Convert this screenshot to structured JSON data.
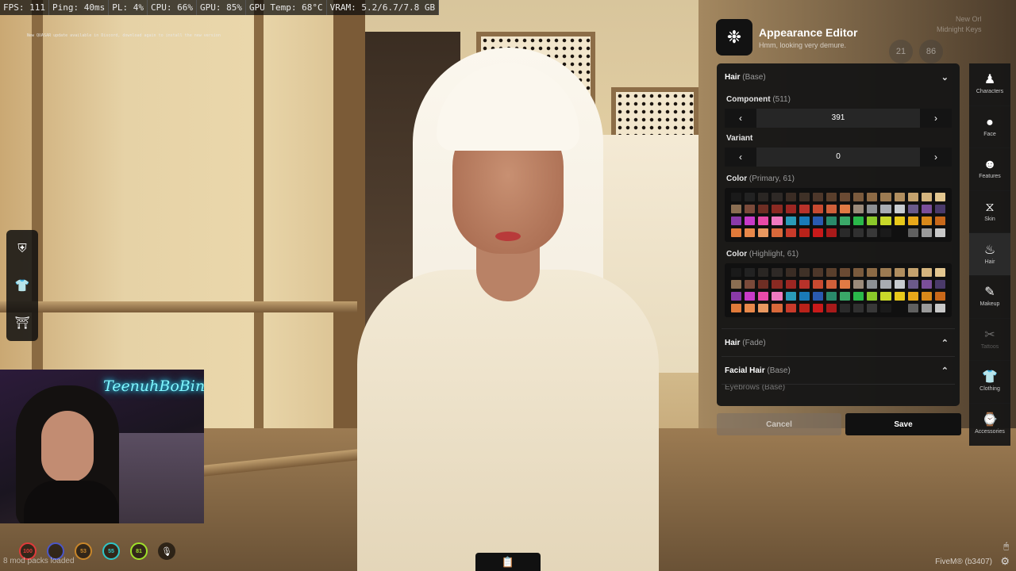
{
  "perf": {
    "fps": "FPS: 111",
    "ping": "Ping: 40ms",
    "pl": "PL: 4%",
    "cpu": "CPU: 66%",
    "gpu": "GPU: 85%",
    "gpu_temp": "GPU Temp: 68°C",
    "vram": "VRAM: 5.2/6.7/7.8 GB"
  },
  "notice": "New QUASAR update available in Discord, download again to install the new version",
  "webcam": {
    "neon_text": "TeenuhBoBina"
  },
  "hud": {
    "health": "100",
    "stat2": "",
    "stat3": "53",
    "stat4": "55",
    "stat5": "81",
    "mic_key": "N",
    "mod_packs": "8 mod packs loaded",
    "fivem_build": "FiveM® (b3407)",
    "colors": [
      "#e03a3a",
      "#4a56c8",
      "#c8862a",
      "#2ec6c8",
      "#9ee02a"
    ]
  },
  "ghost": {
    "lines": [
      "New Orl",
      "Midnight Keys"
    ],
    "nums": [
      "21",
      "86"
    ]
  },
  "editor": {
    "title": "Appearance Editor",
    "subtitle": "Hmm, looking very demure.",
    "sections": {
      "hair_base": {
        "label": "Hair",
        "sub": "(Base)"
      },
      "component": {
        "label": "Component",
        "sub": "(511)",
        "value": "391"
      },
      "variant": {
        "label": "Variant",
        "value": "0"
      },
      "color_primary": {
        "label": "Color",
        "sub": "(Primary, 61)"
      },
      "color_highlight": {
        "label": "Color",
        "sub": "(Highlight, 61)"
      },
      "hair_fade": {
        "label": "Hair",
        "sub": "(Fade)"
      },
      "facial_hair": {
        "label": "Facial Hair",
        "sub": "(Base)"
      },
      "eyebrows": {
        "label": "Eyebrows",
        "sub": "(Base)"
      }
    },
    "palette": [
      "#1a1a1a",
      "#222222",
      "#2a2623",
      "#2e2926",
      "#3a2c24",
      "#3f3127",
      "#4d372a",
      "#5a3f2c",
      "#6a4a33",
      "#7a5a3d",
      "#8c6a45",
      "#9c7b52",
      "#b08e5f",
      "#c4a26e",
      "#d4b47e",
      "#e2c690",
      "#8a6e52",
      "#7a4a3a",
      "#6e2e24",
      "#8a2a22",
      "#9c2622",
      "#b8322a",
      "#c84a30",
      "#d0603a",
      "#e07a44",
      "#9a8a7a",
      "#8c9094",
      "#a8acb2",
      "#c8ccd0",
      "#6a5a8a",
      "#7a4e9a",
      "#4a3a6a",
      "#8a3aa8",
      "#c83ac8",
      "#e84aa8",
      "#f07ac0",
      "#2a9ab8",
      "#1a7ab8",
      "#2a5ab0",
      "#2a8a6a",
      "#3aa868",
      "#2ab84a",
      "#8ac82a",
      "#c8d82a",
      "#e8c81a",
      "#e8a81a",
      "#d8881a",
      "#c8681a",
      "#e07a3a",
      "#e8884a",
      "#e89860",
      "#d8683a",
      "#c83a2a",
      "#b8221a",
      "#c81a1a",
      "#a81a1a",
      "#2a2a2a",
      "#303030",
      "#383838",
      "#1a1a1a",
      "#101010",
      "#606060",
      "#9a9a9a",
      "#c8c8c8"
    ],
    "cancel": "Cancel",
    "save": "Save"
  },
  "categories": [
    {
      "name": "Characters",
      "icon": "person-icon",
      "glyph": "🯅"
    },
    {
      "name": "Face",
      "icon": "face-icon",
      "glyph": "●"
    },
    {
      "name": "Features",
      "icon": "features-icon",
      "glyph": "☻"
    },
    {
      "name": "Skin",
      "icon": "dna-icon",
      "glyph": "⧖"
    },
    {
      "name": "Hair",
      "icon": "hair-icon",
      "glyph": "♨"
    },
    {
      "name": "Makeup",
      "icon": "brush-icon",
      "glyph": "✎"
    },
    {
      "name": "Tattoos",
      "icon": "tattoo-icon",
      "glyph": "✂"
    },
    {
      "name": "Clothing",
      "icon": "shirt-icon",
      "glyph": "👕"
    },
    {
      "name": "Accessories",
      "icon": "watch-icon",
      "glyph": "⌚"
    }
  ]
}
